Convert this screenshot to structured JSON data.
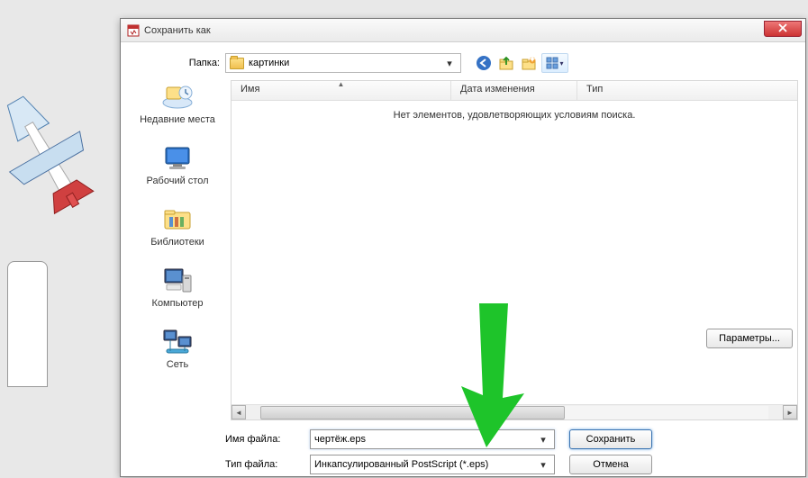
{
  "dialog": {
    "title": "Сохранить как",
    "folder_label": "Папка:",
    "folder_value": "картинки",
    "empty_message": "Нет элементов, удовлетворяющих условиям поиска.",
    "params_button": "Параметры..."
  },
  "columns": {
    "name": "Имя",
    "date": "Дата изменения",
    "type": "Тип"
  },
  "places": [
    {
      "key": "recent",
      "label": "Недавние места"
    },
    {
      "key": "desktop",
      "label": "Рабочий стол"
    },
    {
      "key": "libraries",
      "label": "Библиотеки"
    },
    {
      "key": "computer",
      "label": "Компьютер"
    },
    {
      "key": "network",
      "label": "Сеть"
    }
  ],
  "inputs": {
    "filename_label": "Имя файла:",
    "filename_value": "чертёж.eps",
    "filetype_label": "Тип файла:",
    "filetype_value": "Инкапсулированный PostScript (*.eps)"
  },
  "buttons": {
    "save": "Сохранить",
    "cancel": "Отмена"
  }
}
